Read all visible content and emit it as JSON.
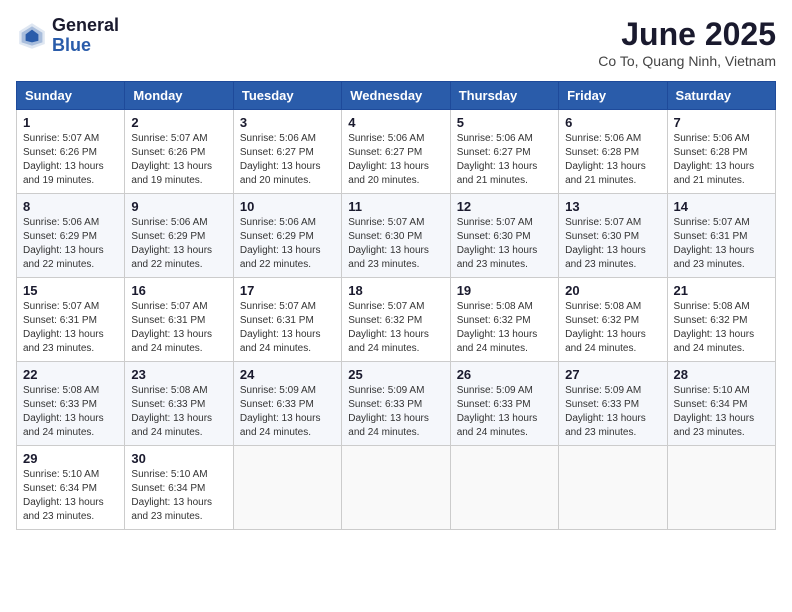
{
  "logo": {
    "general": "General",
    "blue": "Blue"
  },
  "title": "June 2025",
  "location": "Co To, Quang Ninh, Vietnam",
  "weekdays": [
    "Sunday",
    "Monday",
    "Tuesday",
    "Wednesday",
    "Thursday",
    "Friday",
    "Saturday"
  ],
  "weeks": [
    [
      {
        "day": "1",
        "sunrise": "5:07 AM",
        "sunset": "6:26 PM",
        "daylight": "13 hours and 19 minutes."
      },
      {
        "day": "2",
        "sunrise": "5:07 AM",
        "sunset": "6:26 PM",
        "daylight": "13 hours and 19 minutes."
      },
      {
        "day": "3",
        "sunrise": "5:06 AM",
        "sunset": "6:27 PM",
        "daylight": "13 hours and 20 minutes."
      },
      {
        "day": "4",
        "sunrise": "5:06 AM",
        "sunset": "6:27 PM",
        "daylight": "13 hours and 20 minutes."
      },
      {
        "day": "5",
        "sunrise": "5:06 AM",
        "sunset": "6:27 PM",
        "daylight": "13 hours and 21 minutes."
      },
      {
        "day": "6",
        "sunrise": "5:06 AM",
        "sunset": "6:28 PM",
        "daylight": "13 hours and 21 minutes."
      },
      {
        "day": "7",
        "sunrise": "5:06 AM",
        "sunset": "6:28 PM",
        "daylight": "13 hours and 21 minutes."
      }
    ],
    [
      {
        "day": "8",
        "sunrise": "5:06 AM",
        "sunset": "6:29 PM",
        "daylight": "13 hours and 22 minutes."
      },
      {
        "day": "9",
        "sunrise": "5:06 AM",
        "sunset": "6:29 PM",
        "daylight": "13 hours and 22 minutes."
      },
      {
        "day": "10",
        "sunrise": "5:06 AM",
        "sunset": "6:29 PM",
        "daylight": "13 hours and 22 minutes."
      },
      {
        "day": "11",
        "sunrise": "5:07 AM",
        "sunset": "6:30 PM",
        "daylight": "13 hours and 23 minutes."
      },
      {
        "day": "12",
        "sunrise": "5:07 AM",
        "sunset": "6:30 PM",
        "daylight": "13 hours and 23 minutes."
      },
      {
        "day": "13",
        "sunrise": "5:07 AM",
        "sunset": "6:30 PM",
        "daylight": "13 hours and 23 minutes."
      },
      {
        "day": "14",
        "sunrise": "5:07 AM",
        "sunset": "6:31 PM",
        "daylight": "13 hours and 23 minutes."
      }
    ],
    [
      {
        "day": "15",
        "sunrise": "5:07 AM",
        "sunset": "6:31 PM",
        "daylight": "13 hours and 23 minutes."
      },
      {
        "day": "16",
        "sunrise": "5:07 AM",
        "sunset": "6:31 PM",
        "daylight": "13 hours and 24 minutes."
      },
      {
        "day": "17",
        "sunrise": "5:07 AM",
        "sunset": "6:31 PM",
        "daylight": "13 hours and 24 minutes."
      },
      {
        "day": "18",
        "sunrise": "5:07 AM",
        "sunset": "6:32 PM",
        "daylight": "13 hours and 24 minutes."
      },
      {
        "day": "19",
        "sunrise": "5:08 AM",
        "sunset": "6:32 PM",
        "daylight": "13 hours and 24 minutes."
      },
      {
        "day": "20",
        "sunrise": "5:08 AM",
        "sunset": "6:32 PM",
        "daylight": "13 hours and 24 minutes."
      },
      {
        "day": "21",
        "sunrise": "5:08 AM",
        "sunset": "6:32 PM",
        "daylight": "13 hours and 24 minutes."
      }
    ],
    [
      {
        "day": "22",
        "sunrise": "5:08 AM",
        "sunset": "6:33 PM",
        "daylight": "13 hours and 24 minutes."
      },
      {
        "day": "23",
        "sunrise": "5:08 AM",
        "sunset": "6:33 PM",
        "daylight": "13 hours and 24 minutes."
      },
      {
        "day": "24",
        "sunrise": "5:09 AM",
        "sunset": "6:33 PM",
        "daylight": "13 hours and 24 minutes."
      },
      {
        "day": "25",
        "sunrise": "5:09 AM",
        "sunset": "6:33 PM",
        "daylight": "13 hours and 24 minutes."
      },
      {
        "day": "26",
        "sunrise": "5:09 AM",
        "sunset": "6:33 PM",
        "daylight": "13 hours and 24 minutes."
      },
      {
        "day": "27",
        "sunrise": "5:09 AM",
        "sunset": "6:33 PM",
        "daylight": "13 hours and 23 minutes."
      },
      {
        "day": "28",
        "sunrise": "5:10 AM",
        "sunset": "6:34 PM",
        "daylight": "13 hours and 23 minutes."
      }
    ],
    [
      {
        "day": "29",
        "sunrise": "5:10 AM",
        "sunset": "6:34 PM",
        "daylight": "13 hours and 23 minutes."
      },
      {
        "day": "30",
        "sunrise": "5:10 AM",
        "sunset": "6:34 PM",
        "daylight": "13 hours and 23 minutes."
      },
      null,
      null,
      null,
      null,
      null
    ]
  ]
}
